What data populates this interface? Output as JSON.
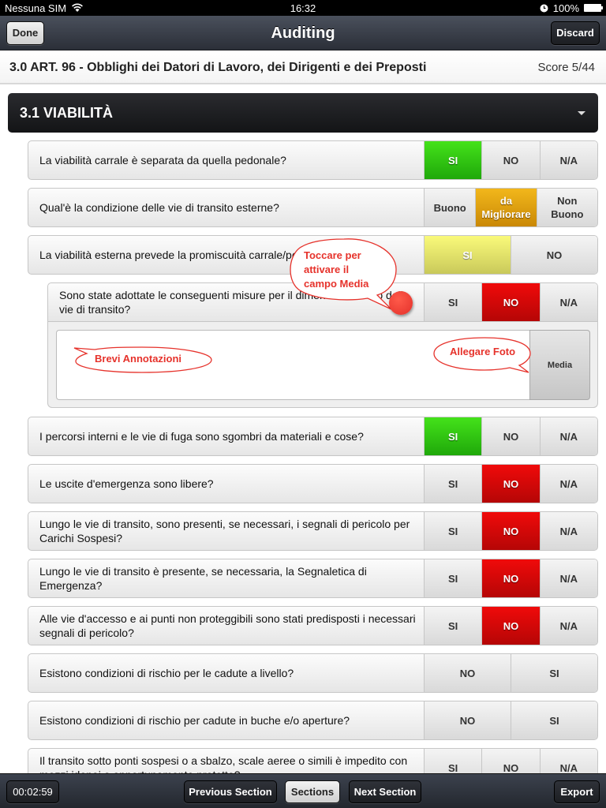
{
  "status_bar": {
    "carrier": "Nessuna SIM",
    "time": "16:32",
    "battery": "100%"
  },
  "nav": {
    "title": "Auditing",
    "done_label": "Done",
    "discard_label": "Discard"
  },
  "header": {
    "title": "3.0 ART. 96 - Obblighi dei Datori di Lavoro, dei Dirigenti e dei Preposti",
    "score": "Score 5/44"
  },
  "section": {
    "title": "3.1  VIABILITÀ"
  },
  "questions": [
    {
      "text": "La viabilità carrale è separata da quella pedonale?",
      "options": [
        "SI",
        "NO",
        "N/A"
      ],
      "selected": "SI",
      "selected_color": "green"
    },
    {
      "text": "Qual'è la condizione delle vie di transito esterne?",
      "options": [
        "Buono",
        "da Migliorare",
        "Non Buono"
      ],
      "selected": "da Migliorare",
      "selected_color": "orange"
    },
    {
      "text": "La viabilità esterna prevede la promiscuità carrale/pedonale?",
      "options": [
        "SI",
        "NO"
      ],
      "selected": "SI",
      "selected_color": "yellow"
    },
    {
      "text": "Sono state adottate le conseguenti misure per il dimensionamento delle vie di transito?",
      "options": [
        "SI",
        "NO",
        "N/A"
      ],
      "selected": "NO",
      "selected_color": "red"
    },
    {
      "text": "I percorsi interni e le vie di fuga sono sgombri da materiali e cose?",
      "options": [
        "SI",
        "NO",
        "N/A"
      ],
      "selected": "SI",
      "selected_color": "green"
    },
    {
      "text": "Le uscite d'emergenza sono libere?",
      "options": [
        "SI",
        "NO",
        "N/A"
      ],
      "selected": "NO",
      "selected_color": "red"
    },
    {
      "text": "Lungo le vie di transito, sono presenti, se necessari, i segnali di pericolo per Carichi Sospesi?",
      "options": [
        "SI",
        "NO",
        "N/A"
      ],
      "selected": "NO",
      "selected_color": "red"
    },
    {
      "text": "Lungo le vie di transito è presente, se necessaria, la Segnaletica di Emergenza?",
      "options": [
        "SI",
        "NO",
        "N/A"
      ],
      "selected": "NO",
      "selected_color": "red"
    },
    {
      "text": "Alle vie d'accesso e ai punti non proteggibili sono stati predisposti i necessari segnali di pericolo?",
      "options": [
        "SI",
        "NO",
        "N/A"
      ],
      "selected": "NO",
      "selected_color": "red"
    },
    {
      "text": "Esistono condizioni di rischio per le cadute a livello?",
      "options": [
        "NO",
        "SI"
      ],
      "selected": null
    },
    {
      "text": "Esistono condizioni di rischio per cadute in buche e/o aperture?",
      "options": [
        "NO",
        "SI"
      ],
      "selected": null
    },
    {
      "text": "Il transito sotto ponti sospesi o a sbalzo, scale aeree o simili è impedito con mezzi idonei o opportunamente protetto?",
      "options": [
        "SI",
        "NO",
        "N/A"
      ],
      "selected": null
    }
  ],
  "subpanel": {
    "media_label": "Media"
  },
  "callouts": {
    "tap_hint": "Toccare per attivare il campo Media",
    "notes_hint": "Brevi Annotazioni",
    "photo_hint": "Allegare Foto"
  },
  "toolbar": {
    "timer": "00:02:59",
    "prev_label": "Previous Section",
    "sections_label": "Sections",
    "next_label": "Next Section",
    "export_label": "Export"
  }
}
